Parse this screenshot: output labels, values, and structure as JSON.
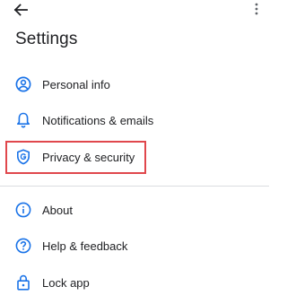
{
  "header": {
    "title": "Settings",
    "back_icon": "arrow-back-icon",
    "more_icon": "more-vert-icon"
  },
  "menu": {
    "items": [
      {
        "label": "Personal info",
        "icon": "account-circle-icon"
      },
      {
        "label": "Notifications & emails",
        "icon": "bell-icon"
      },
      {
        "label": "Privacy & security",
        "icon": "shield-g-icon"
      },
      {
        "label": "About",
        "icon": "info-icon"
      },
      {
        "label": "Help & feedback",
        "icon": "help-icon"
      },
      {
        "label": "Lock app",
        "icon": "lock-icon"
      }
    ]
  },
  "colors": {
    "icon_blue": "#1a73e8",
    "text": "#202124",
    "divider": "#dadce0",
    "highlight_border": "#e0474c"
  }
}
